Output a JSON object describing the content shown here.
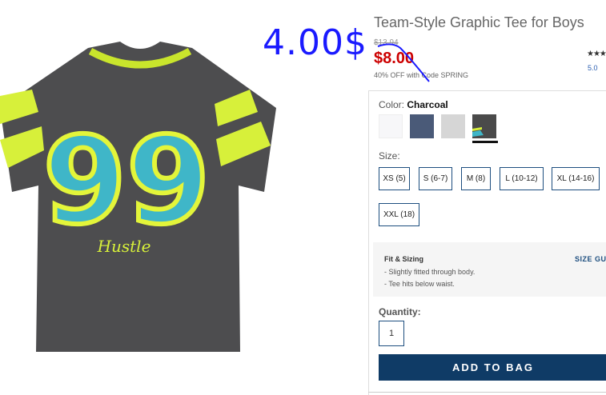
{
  "annotation": {
    "handwritten_price": "4.00$"
  },
  "product": {
    "title": "Team-Style Graphic Tee for Boys",
    "original_price": "$13.94",
    "sale_price": "$8.00",
    "promo": "40% OFF with Code SPRING",
    "stars": "★★★",
    "rating": "5.0",
    "image_text": {
      "number": "99",
      "script": "Hustle"
    }
  },
  "options": {
    "color_label": "Color:",
    "color_value": "Charcoal",
    "swatches": [
      {
        "name": "white",
        "color": "#f7f7f9"
      },
      {
        "name": "navy-heather",
        "color": "#4a5a78"
      },
      {
        "name": "light-gray",
        "color": "#d6d6d6"
      },
      {
        "name": "charcoal",
        "color": "#4a4a4a"
      }
    ],
    "size_label": "Size:",
    "sizes": [
      "XS (5)",
      "S (6-7)",
      "M (8)",
      "L (10-12)",
      "XL (14-16)",
      "XXL (18)"
    ]
  },
  "fit": {
    "title": "Fit & Sizing",
    "lines": [
      "- Slightly fitted through body.",
      "- Tee hits below waist."
    ],
    "size_guide": "SIZE GU"
  },
  "quantity": {
    "label": "Quantity:",
    "value": "1"
  },
  "cart": {
    "add_label": "ADD TO BAG"
  },
  "colors": {
    "brand": "#0f3b66",
    "sale": "#cc0000",
    "annotation": "#1a1aff",
    "accent_yellow": "#d7f03a"
  }
}
